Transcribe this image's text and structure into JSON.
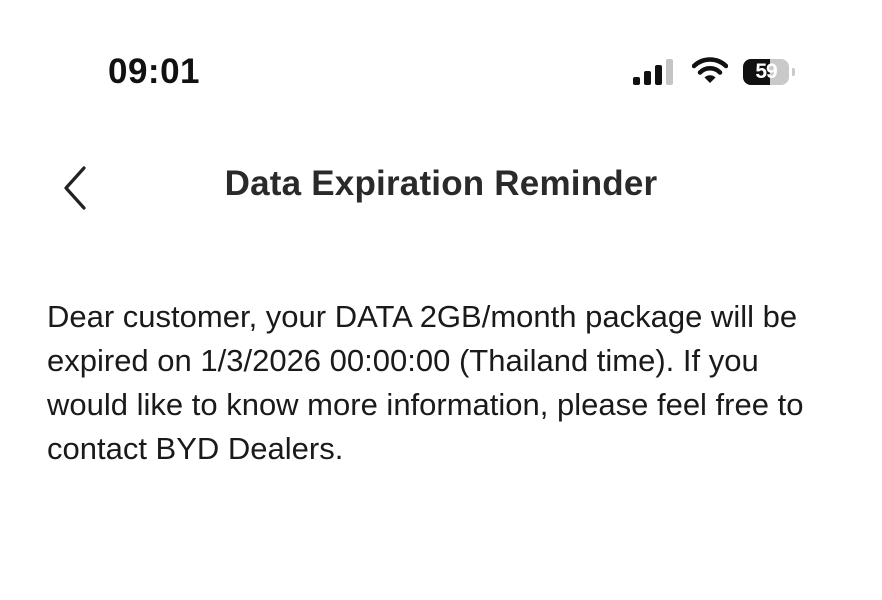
{
  "status_bar": {
    "time": "09:01",
    "battery_level": "59",
    "icons": [
      "cellular-signal-icon",
      "wifi-icon",
      "battery-icon"
    ]
  },
  "nav": {
    "back_icon": "chevron-left-icon",
    "title": "Data Expiration Reminder"
  },
  "message": {
    "body": "Dear customer, your DATA 2GB/month package will be expired on 1/3/2026 00:00:00 (Thailand time). If you would like to know more information, please feel free to contact BYD Dealers."
  },
  "colors": {
    "background": "#ffffff",
    "text": "#1a1a1a",
    "battery_bg": "#c9c9c9",
    "battery_fill": "#111111"
  }
}
